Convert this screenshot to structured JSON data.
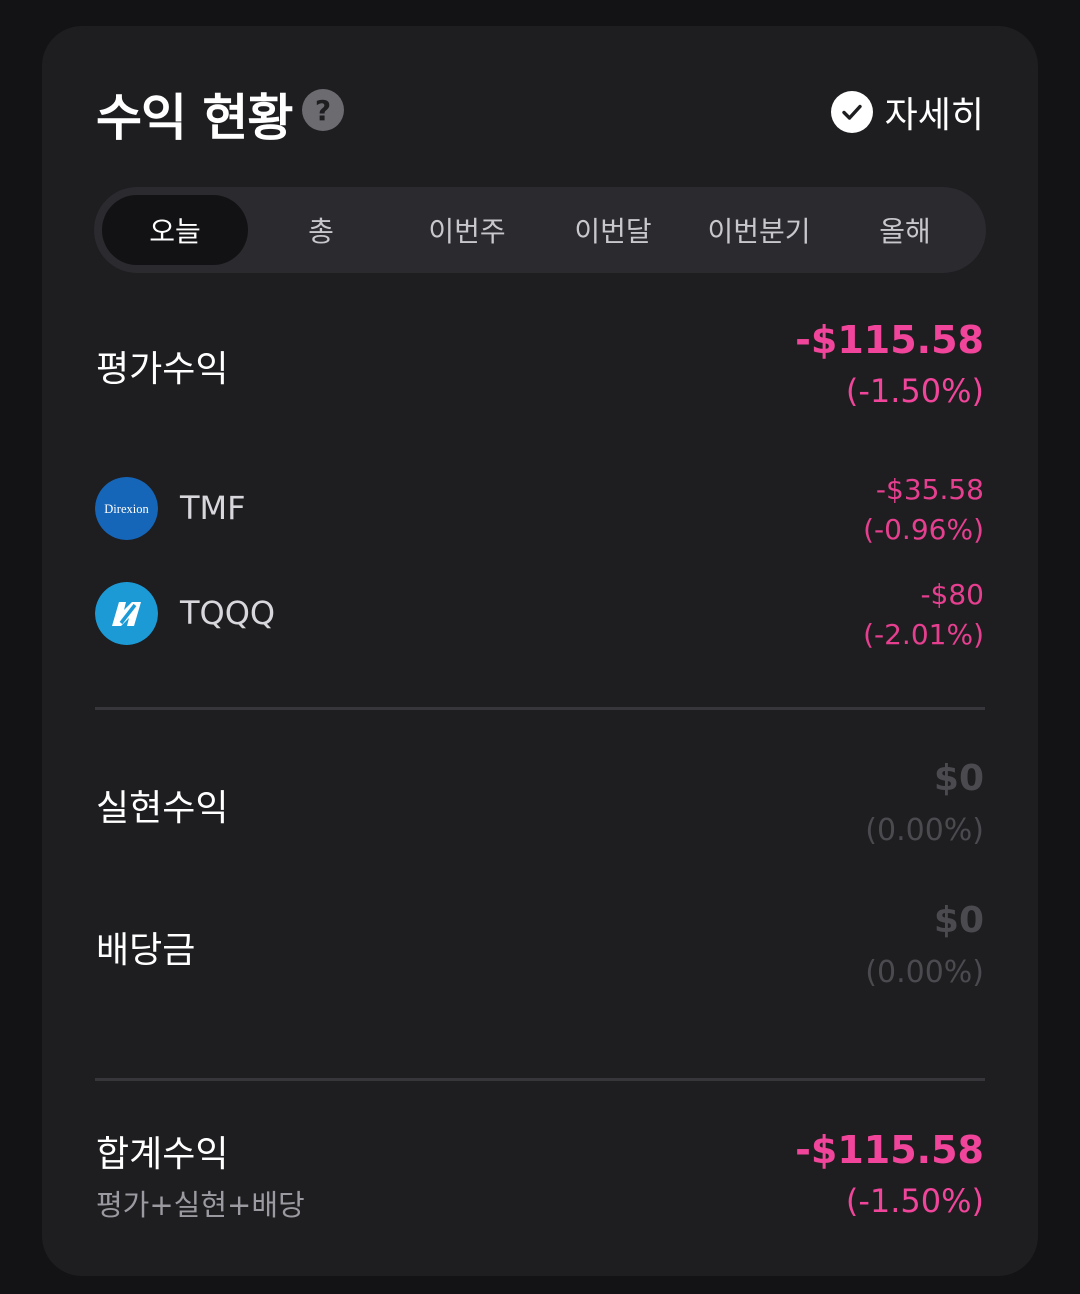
{
  "header": {
    "title": "수익 현황",
    "help_glyph": "?",
    "detail_label": "자세히",
    "detail_checked": true
  },
  "tabs": [
    {
      "label": "오늘",
      "active": true
    },
    {
      "label": "총",
      "active": false
    },
    {
      "label": "이번주",
      "active": false
    },
    {
      "label": "이번달",
      "active": false
    },
    {
      "label": "이번분기",
      "active": false
    },
    {
      "label": "올해",
      "active": false
    }
  ],
  "unrealized": {
    "label": "평가수익",
    "amount": "-$115.58",
    "percent": "(-1.50%)"
  },
  "holdings": [
    {
      "logo_text": "Direxion",
      "name": "TMF",
      "amount": "-$35.58",
      "percent": "(-0.96%)",
      "icon": "direxion-logo-icon"
    },
    {
      "name": "TQQQ",
      "amount": "-$80",
      "percent": "(-2.01%)",
      "icon": "proshares-logo-icon"
    }
  ],
  "realized": {
    "label": "실현수익",
    "amount": "$0",
    "percent": "(0.00%)"
  },
  "dividend": {
    "label": "배당금",
    "amount": "$0",
    "percent": "(0.00%)"
  },
  "total": {
    "label": "합계수익",
    "sublabel": "평가+실현+배당",
    "amount": "-$115.58",
    "percent": "(-1.50%)"
  },
  "colors": {
    "background": "#131315",
    "card": "#1e1e21",
    "loss": "#f0459a",
    "muted": "#4a4a4f"
  }
}
